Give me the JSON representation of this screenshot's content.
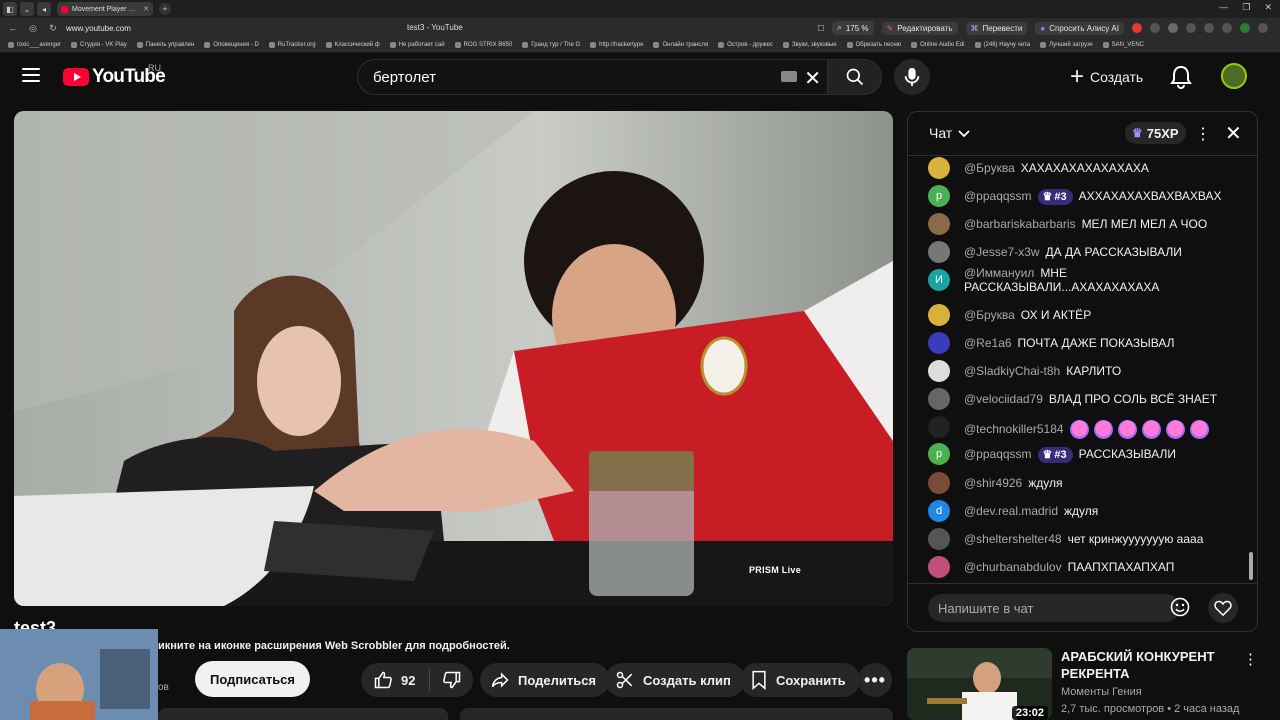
{
  "browser": {
    "tab_title": "Movement Player Uses N",
    "url": "www.youtube.com",
    "page_title": "test3 - YouTube",
    "zoom": "175 %",
    "edit_label": "Редактировать",
    "translate_label": "Перевести",
    "alice_label": "Спросить Алису AI",
    "bookmarks": [
      "toxic___avenger",
      "Студия - VK Play",
      "Панель управлен",
      "Оповещения - D",
      "RuTracker.org",
      "Классический ф",
      "Не работает сай",
      "ROG STRIX B650",
      "Гранд тур / The G",
      "http://hackertype",
      "Онлайн трансля",
      "Остров - дружес",
      "Звуки, звуковые",
      "Обрезать песню",
      "Online Audio Edi",
      "(246) Научу чита",
      "Лучший загрузч",
      "SAN_VENC"
    ]
  },
  "header": {
    "logo_text": "YouTube",
    "region": "RU",
    "search_value": "бертолет",
    "create_label": "Создать"
  },
  "player": {
    "overlay_text": "PRISM Live"
  },
  "video": {
    "title": "test3",
    "scrobbler_text": "икните на иконке расширения Web Scrobbler для подробностей.",
    "subs_tail": "ов",
    "subscribe_label": "Подписаться",
    "likes": "92",
    "share_label": "Поделиться",
    "clip_label": "Создать клип",
    "save_label": "Сохранить"
  },
  "chat": {
    "title": "Чат",
    "xp": "75XP",
    "input_placeholder": "Напишите в чат",
    "messages": [
      {
        "user": "@Бруква",
        "text": "ХАХАХАХАХАХАХАХА",
        "avatar": "",
        "color": "#d8b23a"
      },
      {
        "user": "@ppaqqssm",
        "rank": "#3",
        "text": "АХХАХАХАХВАХВАХВАХ",
        "avatar": "p",
        "color": "#4caf50"
      },
      {
        "user": "@barbariskabarbaris",
        "text": "МЕЛ МЕЛ МЕЛ А ЧОО",
        "avatar": "",
        "color": "#8a6a4a"
      },
      {
        "user": "@Jesse7-x3w",
        "text": "ДА ДА РАССКАЗЫВАЛИ",
        "avatar": "",
        "color": "#777777"
      },
      {
        "user": "@Иммануил",
        "text": "МНЕ РАССКАЗЫВАЛИ...АХАХАХАХАХА",
        "avatar": "И",
        "color": "#1aa3a3"
      },
      {
        "user": "@Бруква",
        "text": "ОХ И АКТЁР",
        "avatar": "",
        "color": "#d8b23a"
      },
      {
        "user": "@Re1a6",
        "text": "ПОЧТА ДАЖЕ ПОКАЗЫВАЛ",
        "avatar": "",
        "color": "#3b3bbd"
      },
      {
        "user": "@SladkiyChai-t8h",
        "text": "КАРЛИТО",
        "avatar": "",
        "color": "#dddddd"
      },
      {
        "user": "@velociidad79",
        "text": "ВЛАД ПРО СОЛЬ ВСЁ ЗНАЕТ",
        "avatar": "",
        "color": "#666666"
      },
      {
        "user": "@technokiller5184",
        "text": "",
        "emojis": 6,
        "avatar": "",
        "color": "#222222"
      },
      {
        "user": "@ppaqqssm",
        "rank": "#3",
        "text": "РАССКАЗЫВАЛИ",
        "avatar": "p",
        "color": "#4caf50"
      },
      {
        "user": "@shir4926",
        "text": "ждуля",
        "avatar": "",
        "color": "#7a4a3a"
      },
      {
        "user": "@dev.real.madrid",
        "text": "ждуля",
        "avatar": "d",
        "color": "#1e88e5"
      },
      {
        "user": "@sheltershelter48",
        "text": "чет кринжууууууую аааа",
        "avatar": "",
        "color": "#555555"
      },
      {
        "user": "@churbanabdulov",
        "text": "ПААПХПАХАПХАП",
        "avatar": "",
        "color": "#c0507a"
      }
    ]
  },
  "recommended": {
    "title": "АРАБСКИЙ КОНКУРЕНТ РЕКРЕНТА",
    "channel": "Моменты Гения",
    "meta": "2,7 тыс. просмотров • 2 часа назад",
    "duration": "23:02"
  }
}
